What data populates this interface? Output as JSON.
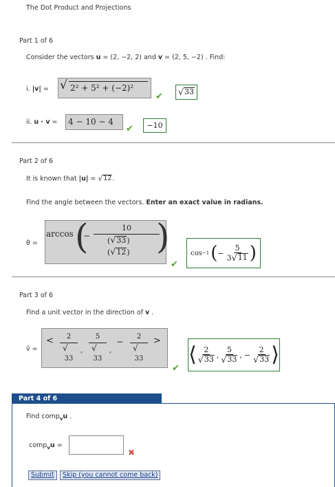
{
  "title": "The Dot Product and Projections",
  "part1": {
    "title": "Part 1 of 6",
    "prompt_start": "Consider the vectors",
    "u_name": "u",
    "u_val": "(2, −2, 2)",
    "and": "and",
    "v_name": "v",
    "v_val": "(2, 5, −2)",
    "find": ". Find:",
    "i_label": "i.",
    "i_var": "|v|",
    "i_eq": "=",
    "i_entry": "2² + 5² + (−2)²",
    "i_answer": "33",
    "ii_label": "ii.",
    "ii_var": "u · v",
    "ii_eq": "=",
    "ii_entry": "4 − 10 − 4",
    "ii_answer": "−10"
  },
  "part2": {
    "title": "Part 2 of 6",
    "known_start": "It is known that",
    "known_var": "|u|",
    "known_eq": "=",
    "known_rad": "12",
    "known_end": ".",
    "find_start": "Find the angle between the vectors.",
    "find_bold": "Enter an exact value in radians.",
    "theta_label": "θ =",
    "entry_fn": "arccos",
    "entry_minus": "−",
    "entry_num": "10",
    "entry_rad1": "33",
    "entry_rad2": "12",
    "answer_fn": "cos",
    "answer_sup": "−1",
    "answer_minus": "−",
    "answer_num": "5",
    "answer_den_coef": "3",
    "answer_den_rad": "11"
  },
  "part3": {
    "title": "Part 3 of 6",
    "prompt": "Find a unit vector in the direction of",
    "prompt_var": "v",
    "prompt_end": ".",
    "label": "v̂ =",
    "entry_open": "<",
    "entry_close": ">",
    "entry_nums": [
      "2",
      "5",
      "2"
    ],
    "entry_rad": "33",
    "entry_sep": ",",
    "entry_minus": "−",
    "answer_open": "⟨",
    "answer_close": "⟩",
    "answer_nums": [
      "2",
      "5",
      "2"
    ],
    "answer_rad": "33"
  },
  "part4": {
    "title": "Part 4 of 6",
    "prompt_start": "Find",
    "prompt_comp": "comp",
    "prompt_sub": "v",
    "prompt_var": "u",
    "prompt_end": ".",
    "label_comp": "comp",
    "label_sub": "v",
    "label_var": "u",
    "label_eq": "=",
    "input_value": "",
    "submit_label": "Submit",
    "skip_label": "Skip (you cannot come back)"
  },
  "icons": {
    "correct": "check-icon",
    "incorrect": "cross-icon"
  },
  "colors": {
    "correct": "#5aa02c",
    "incorrect": "#d9534f",
    "tab": "#1e4e8c",
    "answer_border": "#2e7d32"
  }
}
